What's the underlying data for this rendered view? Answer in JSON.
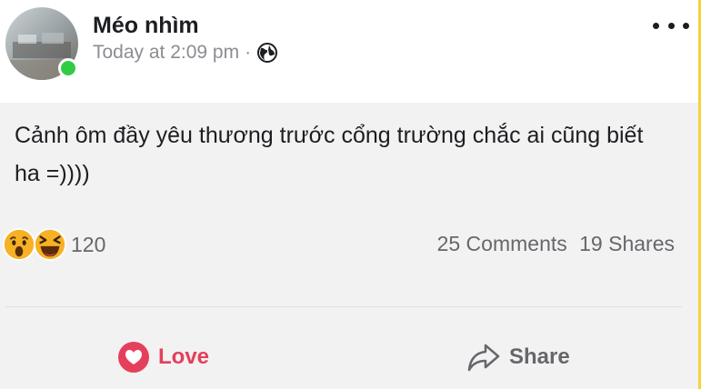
{
  "post": {
    "author": "Méo nhìm",
    "timestamp": "Today at 2:09 pm",
    "separator": "·",
    "privacy_icon": "globe-icon",
    "more_icon": "more-options-icon",
    "text": "Cảnh ôm đầy yêu thương trước cổng trường chắc ai cũng biết ha =))))"
  },
  "reactions": {
    "icons": [
      "wow-reaction-icon",
      "haha-reaction-icon"
    ],
    "count": "120"
  },
  "stats": {
    "comments": "25 Comments",
    "shares": "19 Shares"
  },
  "actions": {
    "love_label": "Love",
    "love_icon": "heart-icon",
    "share_label": "Share",
    "share_icon": "share-arrow-icon"
  },
  "colors": {
    "love": "#e4405b",
    "online": "#31cc46",
    "reaction_yellow": "#f7b125",
    "muted_text": "#65676b",
    "border_accent": "#f5d23c"
  }
}
